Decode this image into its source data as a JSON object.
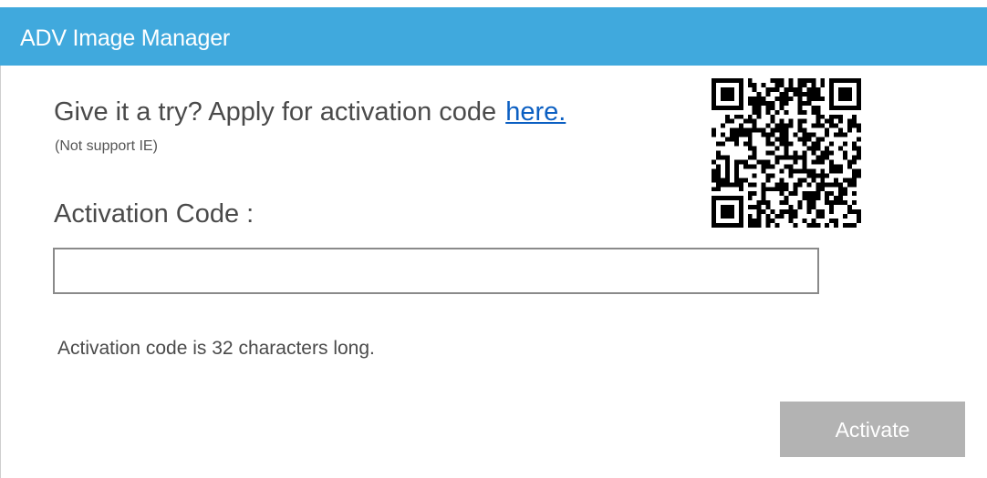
{
  "window": {
    "title": "ADV Image Manager",
    "accent_color": "#40a9dd"
  },
  "promo": {
    "text": "Give it a try? Apply for activation code",
    "link_label": "here.",
    "note": "(Not support IE)",
    "qr_icon": "qr-code-icon"
  },
  "activation": {
    "label": "Activation Code :",
    "input_value": "",
    "input_placeholder": "",
    "hint": "Activation code is 32 characters long.",
    "button_label": "Activate",
    "button_state": "disabled",
    "button_color": "#b3b3b3"
  }
}
